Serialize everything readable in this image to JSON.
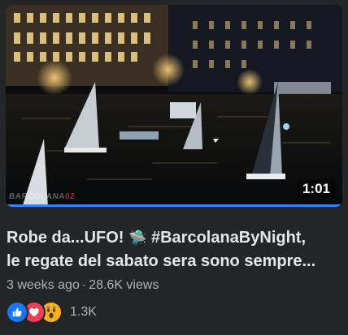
{
  "video": {
    "duration": "1:01",
    "watermark_text": "BARCOLANA",
    "watermark_number": "62",
    "progress_fraction": 1.0,
    "progress_color": "#2d88ff"
  },
  "post": {
    "title_line1": "Robe da...UFO! ",
    "title_emoji": "🛸",
    "title_line1_rest": " #BarcolanaByNight,",
    "title_line2": "le regate del sabato sera sono sempre...",
    "age": "3 weeks ago",
    "separator": "·",
    "views": "28.6K views"
  },
  "reactions": {
    "types": [
      "like-icon",
      "love-icon",
      "wow-icon"
    ],
    "count": "1.3K",
    "colors": {
      "like": "#1877f2",
      "love": "#f33e58",
      "wow": "#f7b125"
    }
  }
}
